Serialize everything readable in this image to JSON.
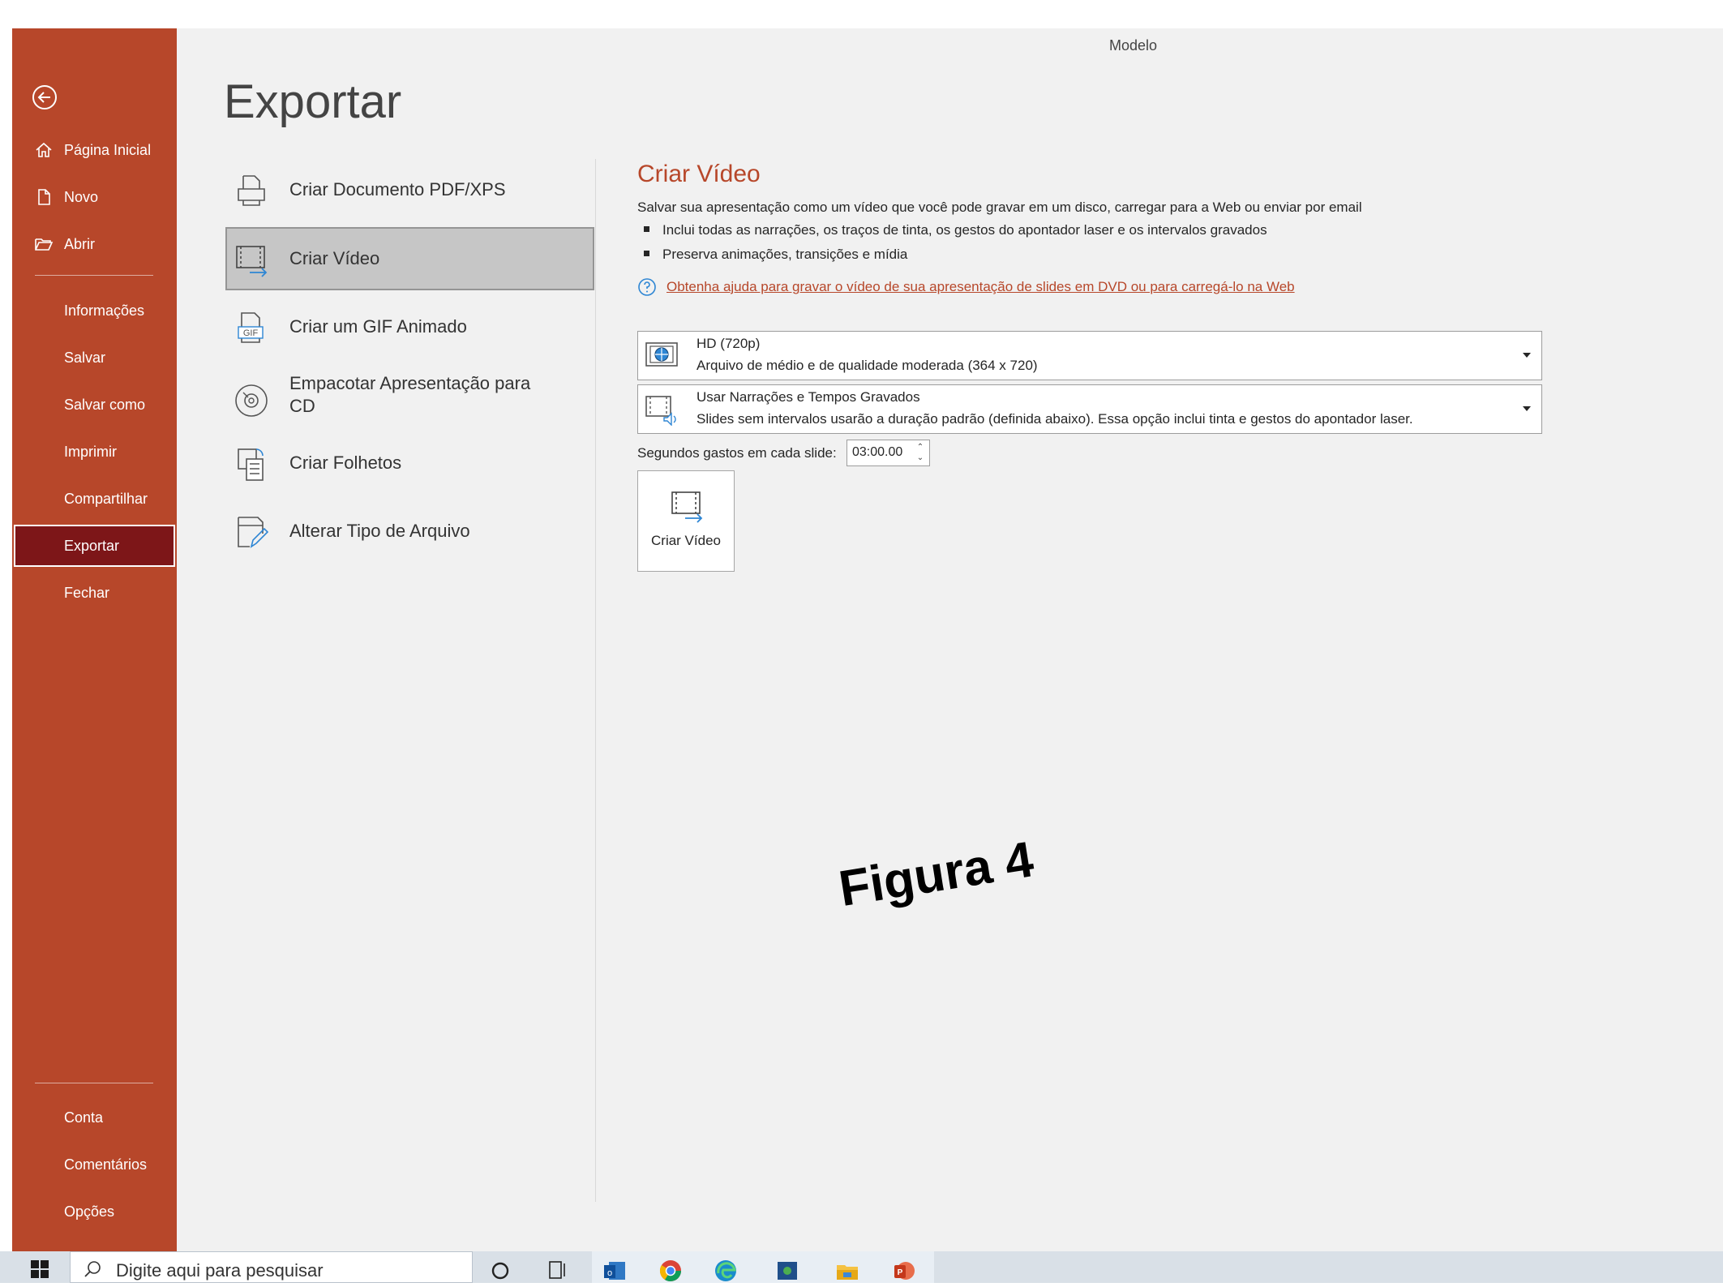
{
  "window": {
    "document_title": "Modelo"
  },
  "sidebar": {
    "back_label": "",
    "items_top": [
      {
        "label": "Página Inicial",
        "icon": "home-icon"
      },
      {
        "label": "Novo",
        "icon": "new-document-icon"
      },
      {
        "label": "Abrir",
        "icon": "open-folder-icon"
      }
    ],
    "items_mid": [
      {
        "label": "Informações"
      },
      {
        "label": "Salvar"
      },
      {
        "label": "Salvar como"
      },
      {
        "label": "Imprimir"
      },
      {
        "label": "Compartilhar"
      },
      {
        "label": "Exportar",
        "active": true
      },
      {
        "label": "Fechar"
      }
    ],
    "items_bottom": [
      {
        "label": "Conta"
      },
      {
        "label": "Comentários"
      },
      {
        "label": "Opções"
      }
    ]
  },
  "page": {
    "title": "Exportar"
  },
  "export_options": [
    {
      "label": "Criar Documento PDF/XPS",
      "icon": "pdf-printer-icon"
    },
    {
      "label": "Criar Vídeo",
      "icon": "video-icon",
      "selected": true
    },
    {
      "label": "Criar um GIF Animado",
      "icon": "gif-icon"
    },
    {
      "label": "Empacotar Apresentação para CD",
      "icon": "cd-icon"
    },
    {
      "label": "Criar Folhetos",
      "icon": "handouts-icon"
    },
    {
      "label": "Alterar Tipo de Arquivo",
      "icon": "change-file-type-icon"
    }
  ],
  "video_panel": {
    "title": "Criar Vídeo",
    "description": "Salvar sua apresentação como um vídeo que você pode gravar em um disco, carregar para a Web ou enviar por email",
    "bullets": [
      "Inclui todas as narrações, os traços de tinta, os gestos do apontador laser e os intervalos gravados",
      "Preserva animações, transições e mídia"
    ],
    "help_link": "Obtenha ajuda para gravar o vídeo de sua apresentação de slides em DVD ou para carregá-lo na Web",
    "quality": {
      "title": "HD (720p)",
      "subtitle": "Arquivo de médio e de qualidade moderada (364 x 720)"
    },
    "timing": {
      "title": "Usar Narrações e Tempos Gravados",
      "subtitle": "Slides sem intervalos usarão a duração padrão (definida abaixo). Essa opção inclui tinta e gestos do apontador laser."
    },
    "seconds_label": "Segundos gastos em cada slide:",
    "seconds_value": "03:00.00",
    "create_button_label": "Criar Vídeo"
  },
  "overlay_caption": "Figura 4",
  "taskbar": {
    "search_placeholder": "Digite aqui para pesquisar",
    "apps": [
      "cortana-icon",
      "task-view-icon",
      "outlook-icon",
      "chrome-icon",
      "edge-icon",
      "photo-app-icon",
      "file-explorer-icon",
      "powerpoint-icon"
    ]
  },
  "colors": {
    "accent": "#b7472a",
    "active_nav": "#7d1618",
    "selected_option": "#c6c6c6"
  }
}
